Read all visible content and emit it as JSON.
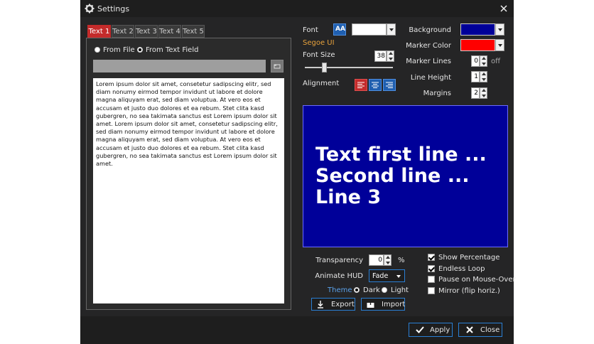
{
  "window": {
    "title": "Settings"
  },
  "tabs": [
    {
      "label": "Text 1",
      "active": true
    },
    {
      "label": "Text 2",
      "active": false
    },
    {
      "label": "Text 3",
      "active": false
    },
    {
      "label": "Text 4",
      "active": false
    },
    {
      "label": "Text 5",
      "active": false
    }
  ],
  "source": {
    "from_file": "From File",
    "from_text_field": "From Text Field",
    "selected": "from_text_field"
  },
  "text_content": "Lorem ipsum dolor sit amet, consetetur sadipscing elitr, sed diam nonumy eirmod tempor invidunt ut labore et dolore magna aliquyam erat, sed diam voluptua. At vero eos et accusam et justo duo dolores et ea rebum. Stet clita kasd gubergren, no sea takimata sanctus est Lorem ipsum dolor sit amet. Lorem ipsum dolor sit amet, consetetur sadipscing elitr, sed diam nonumy eirmod tempor invidunt ut labore et dolore magna aliquyam erat, sed diam voluptua. At vero eos et accusam et justo duo dolores et ea rebum. Stet clita kasd gubergren, no sea takimata sanctus est Lorem ipsum dolor sit amet.",
  "font": {
    "label": "Font",
    "name": "Segoe UI",
    "size_label": "Font Size",
    "size": "38",
    "alignment_label": "Alignment",
    "alignment": "left"
  },
  "colors": {
    "background_label": "Background",
    "background": "#000099",
    "marker_color_label": "Marker Color",
    "marker_color": "#ff0000",
    "accent": "#2a7fd4",
    "tab_active": "#c42b2b"
  },
  "marker_lines": {
    "label": "Marker Lines",
    "value": "0",
    "suffix": "off"
  },
  "line_height": {
    "label": "Line Height",
    "value": "1"
  },
  "margins": {
    "label": "Margins",
    "value": "2"
  },
  "preview": {
    "lines": [
      "Text first line ...",
      "Second line ...",
      "Line 3"
    ]
  },
  "transparency": {
    "label": "Transparency",
    "value": "0",
    "unit": "%"
  },
  "animate_hud": {
    "label": "Animate HUD",
    "value": "Fade"
  },
  "theme": {
    "label": "Theme",
    "dark": "Dark",
    "light": "Light",
    "selected": "dark"
  },
  "options": [
    {
      "label": "Show Percentage",
      "checked": true
    },
    {
      "label": "Endless Loop",
      "checked": true
    },
    {
      "label": "Pause on Mouse-Over",
      "checked": false
    },
    {
      "label": "Mirror (flip horiz.)",
      "checked": false
    }
  ],
  "buttons": {
    "export": "Export",
    "import": "Import",
    "apply": "Apply",
    "close": "Close"
  },
  "icons": [
    "gear-icon",
    "close-icon",
    "folder-icon",
    "font-icon",
    "align-left-icon",
    "align-center-icon",
    "align-right-icon",
    "download-icon",
    "upload-icon",
    "check-icon",
    "x-icon"
  ]
}
